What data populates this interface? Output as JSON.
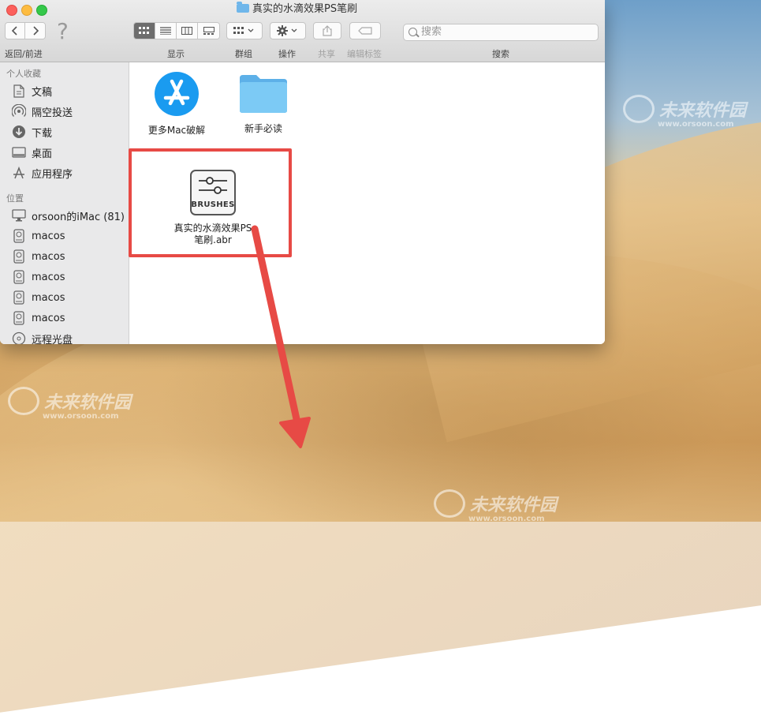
{
  "window": {
    "title": "真实的水滴效果PS笔刷"
  },
  "toolbar": {
    "back_forward_label": "返回/前进",
    "view_label": "显示",
    "group_label": "群组",
    "action_label": "操作",
    "share_label": "共享",
    "tags_label": "编辑标签",
    "search_label": "搜索",
    "search_placeholder": "搜索"
  },
  "sidebar": {
    "favorites_header": "个人收藏",
    "favorites": [
      {
        "label": "文稿",
        "icon": "document-icon"
      },
      {
        "label": "隔空投送",
        "icon": "airdrop-icon"
      },
      {
        "label": "下载",
        "icon": "download-icon"
      },
      {
        "label": "桌面",
        "icon": "desktop-icon"
      },
      {
        "label": "应用程序",
        "icon": "applications-icon"
      }
    ],
    "locations_header": "位置",
    "locations": [
      {
        "label": "orsoon的iMac (81)",
        "icon": "imac-icon"
      },
      {
        "label": "macos",
        "icon": "disk-icon"
      },
      {
        "label": "macos",
        "icon": "disk-icon"
      },
      {
        "label": "macos",
        "icon": "disk-icon"
      },
      {
        "label": "macos",
        "icon": "disk-icon"
      },
      {
        "label": "macos",
        "icon": "disk-icon"
      },
      {
        "label": "远程光盘",
        "icon": "remote-disc-icon"
      }
    ]
  },
  "files": [
    {
      "label": "更多Mac破解",
      "icon": "app-store-icon"
    },
    {
      "label": "新手必读",
      "icon": "folder-icon"
    },
    {
      "label_line1": "真实的水滴效果PS",
      "label_line2": "笔刷.abr",
      "icon": "brushes-file-icon",
      "badge": "BRUSHES"
    }
  ],
  "watermark": {
    "name": "未来软件园",
    "url": "www.orsoon.com"
  },
  "colors": {
    "highlight": "#e74a45",
    "arrow": "#e74a45",
    "app_store_blue": "#1a9bf0",
    "folder_blue": "#6fc0f2"
  }
}
